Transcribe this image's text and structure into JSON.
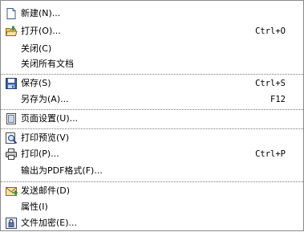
{
  "menu": {
    "items": [
      {
        "label": "新建(N)...",
        "shortcut": "",
        "icon": "new-document-icon"
      },
      {
        "label": "打开(O)...",
        "shortcut": "Ctrl+O",
        "icon": "open-folder-icon"
      },
      {
        "label": "关闭(C)",
        "shortcut": "",
        "icon": ""
      },
      {
        "label": "关闭所有文档",
        "shortcut": "",
        "icon": ""
      },
      {
        "label": "保存(S)",
        "shortcut": "Ctrl+S",
        "icon": "save-disk-icon"
      },
      {
        "label": "另存为(A)...",
        "shortcut": "F12",
        "icon": ""
      },
      {
        "label": "页面设置(U)...",
        "shortcut": "",
        "icon": "page-setup-icon"
      },
      {
        "label": "打印预览(V)",
        "shortcut": "",
        "icon": "print-preview-icon"
      },
      {
        "label": "打印(P)...",
        "shortcut": "Ctrl+P",
        "icon": "printer-icon"
      },
      {
        "label": "输出为PDF格式(F)...",
        "shortcut": "",
        "icon": ""
      },
      {
        "label": "发送邮件(D)",
        "shortcut": "",
        "icon": "send-mail-icon"
      },
      {
        "label": "属性(I)",
        "shortcut": "",
        "icon": ""
      },
      {
        "label": "文件加密(E)...",
        "shortcut": "",
        "icon": "encrypt-file-icon"
      }
    ]
  }
}
